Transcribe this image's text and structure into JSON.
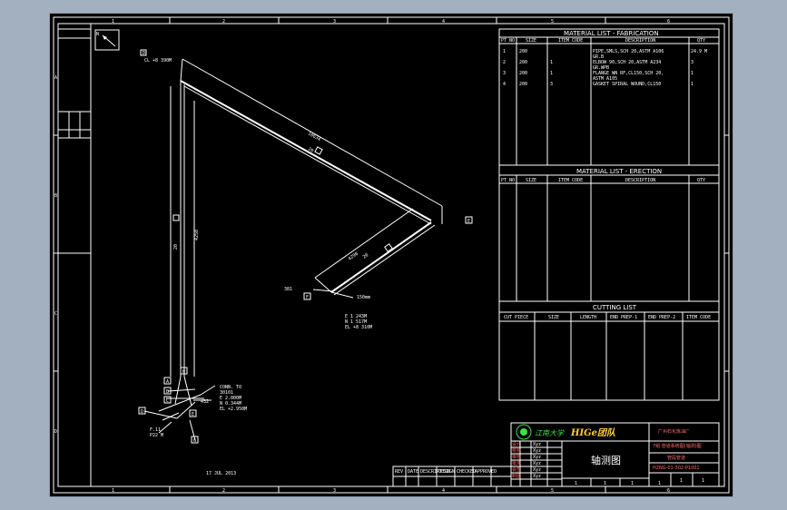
{
  "border": {
    "col_numbers": [
      "1",
      "2",
      "3",
      "4",
      "5",
      "6"
    ],
    "row_letters": [
      "A",
      "B",
      "C",
      "D"
    ]
  },
  "north_marker": {
    "label": "N"
  },
  "material_fab": {
    "title": "MATERIAL  LIST  -  FABRICATION",
    "headers": [
      "PT NO",
      "SIZE",
      "ITEM CODE",
      "DESCRIPTION",
      "QTY"
    ],
    "rows": [
      {
        "pt": "1",
        "size": "200",
        "code": "",
        "desc": [
          "PIPE,SMLS,SCH 20,ASTM A106",
          "GR.B"
        ],
        "qty": "24.9 M"
      },
      {
        "pt": "2",
        "size": "200",
        "code": "1",
        "desc": [
          "ELBOW 90,SCH 20,ASTM A234",
          "GR.WPB"
        ],
        "qty": "3"
      },
      {
        "pt": "3",
        "size": "200",
        "code": "1",
        "desc": [
          "FLANGE WN RF,CL150,SCH 20,",
          "ASTM A105"
        ],
        "qty": "1"
      },
      {
        "pt": "4",
        "size": "200",
        "code": "3",
        "desc": [
          "GASKET SPIRAL WOUND,CL150"
        ],
        "qty": "1"
      }
    ]
  },
  "material_erec": {
    "title": "MATERIAL  LIST  -  ERECTION",
    "headers": [
      "PT NO",
      "SIZE",
      "ITEM CODE",
      "DESCRIPTION",
      "QTY"
    ]
  },
  "cutting": {
    "title": "CUTTING  LIST",
    "headers": [
      "CUT PIECE",
      "SIZE",
      "LENGTH",
      "END PREP-1",
      "END PREP-2",
      "ITEM CODE"
    ]
  },
  "drawing": {
    "top_callout": "CL +8 390M",
    "top_flag": "D",
    "dim_top_diag": "10634",
    "tag_top_diag": "20",
    "tag_top_diag_box": "2",
    "dim_vertical": "4250",
    "tag_vertical": "20",
    "tag_vertical_box": "2",
    "dim_lower_diag": "4290",
    "tag_lower_diag": "20",
    "tag_lower_diag_box": "2",
    "corner_flag": "E",
    "left_mark": "381",
    "left_flag": "F",
    "mid_note": "150mm",
    "coord_block": [
      "E 1 243M",
      "N 1 517M",
      "EL +8 310M"
    ],
    "conn_block": [
      "CONN. TO",
      "30101",
      "E 2.000M",
      "N 0.344M",
      "EL +2.950M"
    ],
    "lower_mark": "432",
    "base_note": [
      "F.11",
      "P22 M"
    ],
    "flags_low": [
      "A",
      "B",
      "C",
      "D",
      "E",
      "G",
      "H"
    ],
    "date": "17 JUL 2013"
  },
  "title_block": {
    "org": "江南大学",
    "team": "HIGe团队",
    "company": "广州石化炼油厂",
    "sheet_title": "轴测图",
    "box_title_lines": [
      "7组.管道系统图(轴测)图",
      "管段管道"
    ],
    "sign_labels": [
      "设计",
      "校核",
      "审核",
      "批准",
      "会签",
      "制图"
    ],
    "sign_names": [
      "Xyz",
      "Xyz",
      "Xyz",
      "Xyz",
      "Xyz",
      "Xyz"
    ],
    "drawing_no": "H2NG-01-302-P1001",
    "sheet_info": [
      "1",
      "1"
    ],
    "rev_headers": [
      "REV",
      "DATE",
      "DESCRIPTION",
      "DESIGN",
      "CHECKED",
      "APPROVED"
    ],
    "bottom_cells": [
      "1",
      "1",
      "1",
      "1"
    ]
  }
}
